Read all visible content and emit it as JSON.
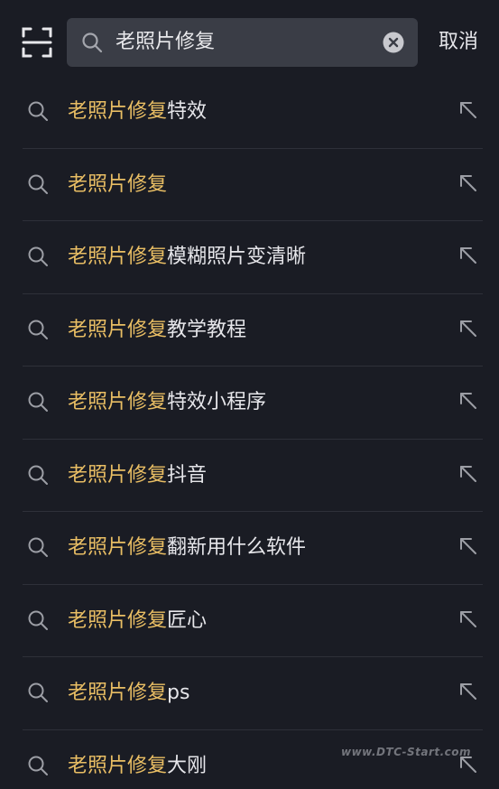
{
  "header": {
    "scan_icon": "scan-icon",
    "search": {
      "icon": "search-icon",
      "value": "老照片修复",
      "clear_icon": "clear-icon"
    },
    "cancel_label": "取消"
  },
  "suggestions": [
    {
      "highlight": "老照片修复",
      "rest": "特效"
    },
    {
      "highlight": "老照片修复",
      "rest": ""
    },
    {
      "highlight": "老照片修复",
      "rest": "模糊照片变清晰"
    },
    {
      "highlight": "老照片修复",
      "rest": "教学教程"
    },
    {
      "highlight": "老照片修复",
      "rest": "特效小程序"
    },
    {
      "highlight": "老照片修复",
      "rest": "抖音"
    },
    {
      "highlight": "老照片修复",
      "rest": "翻新用什么软件"
    },
    {
      "highlight": "老照片修复",
      "rest": "匠心"
    },
    {
      "highlight": "老照片修复",
      "rest": "ps"
    },
    {
      "highlight": "老照片修复",
      "rest": "大刚"
    }
  ],
  "suggestion_icons": {
    "left": "search-icon",
    "right": "arrow-up-left-icon"
  },
  "watermark": "www.DTC-Start.com",
  "colors": {
    "background": "#1a1c24",
    "search_box": "#3a3d46",
    "highlight": "#e9be64",
    "text": "#e6e6ea",
    "divider": "#2e3039"
  }
}
